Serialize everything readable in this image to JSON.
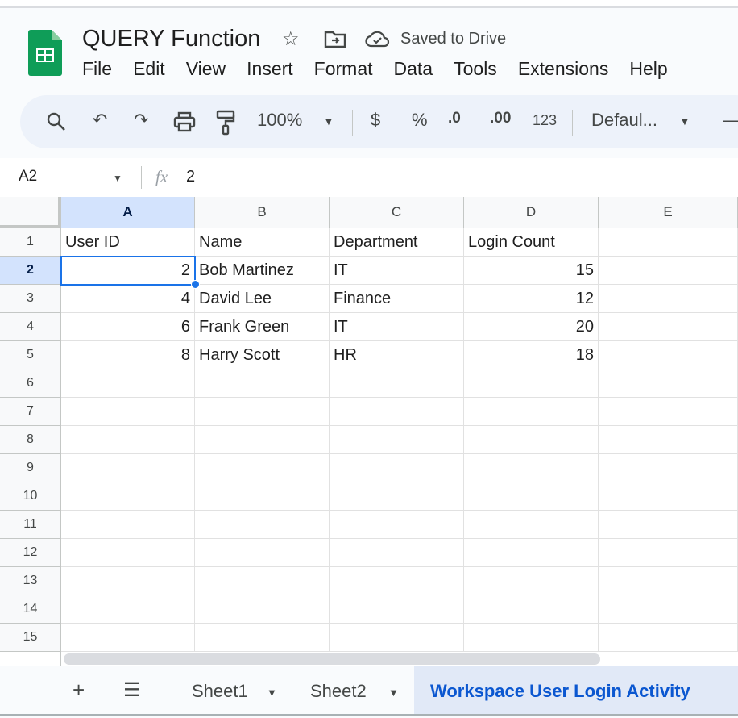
{
  "doc": {
    "title": "QUERY Function",
    "save_status": "Saved to Drive"
  },
  "menu": [
    "File",
    "Edit",
    "View",
    "Insert",
    "Format",
    "Data",
    "Tools",
    "Extensions",
    "Help"
  ],
  "toolbar": {
    "zoom": "100%",
    "currency": "$",
    "percent": "%",
    "dec_decrease": ".0",
    "dec_increase": ".00",
    "number_format": "123",
    "font": "Defaul..."
  },
  "formula_bar": {
    "cell_ref": "A2",
    "fx": "fx",
    "value": "2"
  },
  "columns": [
    "A",
    "B",
    "C",
    "D",
    "E"
  ],
  "rows": [
    "1",
    "2",
    "3",
    "4",
    "5",
    "6",
    "7",
    "8",
    "9",
    "10",
    "11",
    "12",
    "13",
    "14",
    "15"
  ],
  "cells": [
    [
      "User ID",
      "Name",
      "Department",
      "Login Count"
    ],
    [
      "2",
      "Bob Martinez",
      "IT",
      "15"
    ],
    [
      "4",
      "David Lee",
      "Finance",
      "12"
    ],
    [
      "6",
      "Frank Green",
      "IT",
      "20"
    ],
    [
      "8",
      "Harry Scott",
      "HR",
      "18"
    ]
  ],
  "sheets": {
    "add": "+",
    "all": "☰",
    "tabs": [
      "Sheet1",
      "Sheet2",
      "Workspace User Login Activity"
    ],
    "active": 2
  },
  "colors": {
    "accent": "#0b57d0",
    "sheets_green": "#0f9d58",
    "selection": "#1a73e8"
  }
}
